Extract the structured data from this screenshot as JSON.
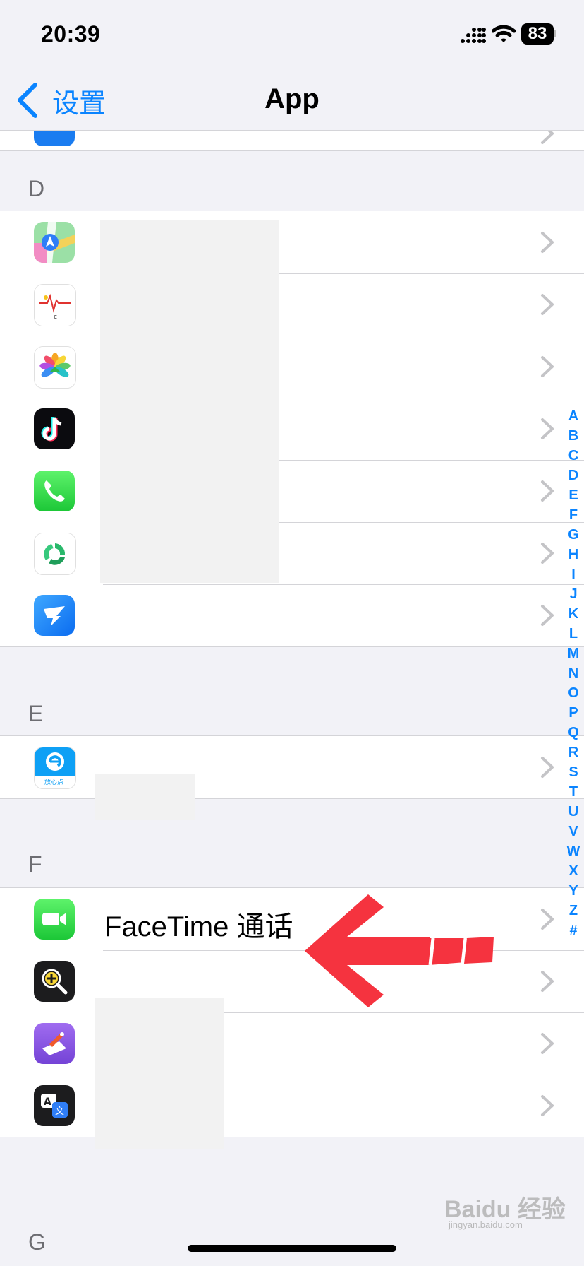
{
  "status_bar": {
    "time": "20:39",
    "battery": "83"
  },
  "nav": {
    "back_label": "设置",
    "title": "App"
  },
  "sections": {
    "d": {
      "letter": "D"
    },
    "e": {
      "letter": "E"
    },
    "f": {
      "letter": "F"
    },
    "g": {
      "letter": "G"
    }
  },
  "rows": {
    "facetime": {
      "label": "FaceTime 通话"
    }
  },
  "index_letters": [
    "A",
    "B",
    "C",
    "D",
    "E",
    "F",
    "G",
    "H",
    "I",
    "J",
    "K",
    "L",
    "M",
    "N",
    "O",
    "P",
    "Q",
    "R",
    "S",
    "T",
    "U",
    "V",
    "W",
    "X",
    "Y",
    "Z",
    "#"
  ],
  "watermark": {
    "text": "Baidu 经验",
    "sub": "jingyan.baidu.com"
  },
  "colors": {
    "accent": "#0a84ff",
    "annotation_arrow": "#f5333f",
    "background": "#f2f2f7"
  }
}
